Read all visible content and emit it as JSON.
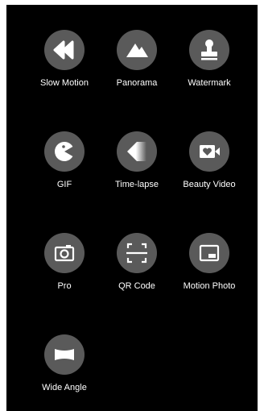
{
  "colors": {
    "background": "#000000",
    "icon_circle": "#5a5a5a",
    "icon_fg": "#ffffff",
    "label": "#ffffff"
  },
  "modes": [
    {
      "label": "Slow Motion",
      "icon": "rewind-icon"
    },
    {
      "label": "Panorama",
      "icon": "mountains-icon"
    },
    {
      "label": "Watermark",
      "icon": "stamp-icon"
    },
    {
      "label": "GIF",
      "icon": "pacman-icon"
    },
    {
      "label": "Time-lapse",
      "icon": "timelapse-icon"
    },
    {
      "label": "Beauty Video",
      "icon": "beauty-video-icon"
    },
    {
      "label": "Pro",
      "icon": "camera-icon"
    },
    {
      "label": "QR Code",
      "icon": "qr-scan-icon"
    },
    {
      "label": "Motion Photo",
      "icon": "motion-photo-icon"
    },
    {
      "label": "Wide Angle",
      "icon": "wide-angle-icon"
    }
  ]
}
